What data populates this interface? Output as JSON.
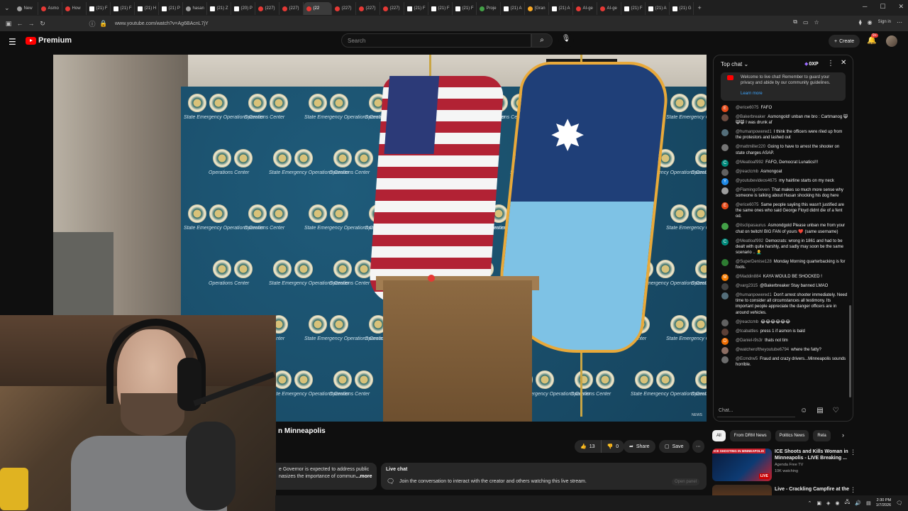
{
  "browser": {
    "tabs": [
      {
        "label": "New",
        "icon": "new-tab-icon"
      },
      {
        "label": "Asmo",
        "icon": "youtube-icon"
      },
      {
        "label": "How",
        "icon": "youtube-icon"
      },
      {
        "label": "(21) F",
        "icon": "x-icon"
      },
      {
        "label": "(21) F",
        "icon": "x-icon"
      },
      {
        "label": "(21) H",
        "icon": "x-icon"
      },
      {
        "label": "(21) P",
        "icon": "x-icon"
      },
      {
        "label": "hasan",
        "icon": "web-icon"
      },
      {
        "label": "(21) Z",
        "icon": "x-icon"
      },
      {
        "label": "(20) P",
        "icon": "x-icon"
      },
      {
        "label": "(227)",
        "icon": "youtube-icon"
      },
      {
        "label": "(227)",
        "icon": "youtube-icon"
      },
      {
        "label": "(22",
        "icon": "youtube-icon",
        "active": true
      },
      {
        "label": "(227)",
        "icon": "youtube-icon"
      },
      {
        "label": "(227)",
        "icon": "youtube-icon"
      },
      {
        "label": "(227)",
        "icon": "youtube-icon"
      },
      {
        "label": "(21) F",
        "icon": "x-icon"
      },
      {
        "label": "(21) F",
        "icon": "x-icon"
      },
      {
        "label": "(21) F",
        "icon": "x-icon"
      },
      {
        "label": "Proje",
        "icon": "project-icon"
      },
      {
        "label": "(21) A",
        "icon": "x-icon"
      },
      {
        "label": "[Gran",
        "icon": "gran-icon"
      },
      {
        "label": "(21) A",
        "icon": "x-icon"
      },
      {
        "label": "AI-ge",
        "icon": "youtube-icon"
      },
      {
        "label": "AI-ge",
        "icon": "youtube-icon"
      },
      {
        "label": "(21) F",
        "icon": "x-icon"
      },
      {
        "label": "(21) A",
        "icon": "x-icon"
      },
      {
        "label": "(21) G",
        "icon": "x-icon"
      }
    ],
    "url": "www.youtube.com/watch?v=Ag6BAcnL7jY",
    "sign_in": "Sign in"
  },
  "youtube": {
    "brand": "Premium",
    "search_placeholder": "Search",
    "create_label": "Create",
    "notif_count": "9+"
  },
  "video": {
    "clock_text": "59",
    "backdrop_caption": "State Emergency Operations Center",
    "backdrop_caption_short": "Operations Center",
    "news_bug": "NEWS"
  },
  "below": {
    "title": "n Minneapolis",
    "likes": "13",
    "dislikes": "0",
    "share": "Share",
    "save": "Save",
    "description_line1": "e Governor is expected to address public",
    "description_line2": "nasizes the importance of commun",
    "description_more": "...more",
    "live_chat_heading": "Live chat",
    "live_chat_text": "Join the conversation to interact with the creator and others watching this live stream.",
    "open_panel": "Open panel"
  },
  "chat": {
    "header": "Top chat",
    "xp": "0XP",
    "welcome": "Welcome to live chat! Remember to guard your privacy and abide by our community guidelines.",
    "learn_more": "Learn more",
    "input_placeholder": "Chat...",
    "messages": [
      {
        "user": "@erice6075",
        "text": "FAFO",
        "avatar": "E",
        "color": "#e64a19"
      },
      {
        "user": "@Bakerbreaker",
        "text": "Asmongold! unban me bro : Cartmanog 😸😸😸 I was drunk af",
        "avatar": "",
        "color": "#6d4c41"
      },
      {
        "user": "@humanpowered1",
        "text": "I think the officers were riled up from the protestors and lashed out",
        "avatar": "",
        "color": "#546e7a"
      },
      {
        "user": "@mattmiller220",
        "text": "Going to have to arrest the shooter on state charges ASAP.",
        "avatar": "",
        "color": "#757575"
      },
      {
        "user": "@Meatloaf992",
        "text": "FAFO, Democrat Lunatics!!!",
        "avatar": "C",
        "color": "#00897b"
      },
      {
        "user": "@jreactcmb",
        "text": "Asmongoat",
        "avatar": "",
        "color": "#616161"
      },
      {
        "user": "@youtubevideos4675",
        "text": "my hairline starts on my neck",
        "avatar": "Y",
        "color": "#1e88e5"
      },
      {
        "user": "@FlamingoSeven",
        "text": "That makes so much more sense why someone is talking about Hasan shocking his dog here",
        "avatar": "",
        "color": "#9e9e9e"
      },
      {
        "user": "@erice6075",
        "text": "Same people sayiing this wasn't justified are the same ones who said George Floyd didnt die of a fent od.",
        "avatar": "E",
        "color": "#e64a19"
      },
      {
        "user": "@itsclipasaurus",
        "text": "Asmondgold Please unban me from your chat on twitch! BIG FAN of yours ❤️ (same username)",
        "avatar": "",
        "color": "#43a047"
      },
      {
        "user": "@Meatloaf992",
        "text": "Democrats: wrong in 1861 and had to be dealt with quite harshly, and sadly may soon be the same scenario .. 👨‍🦲",
        "avatar": "C",
        "color": "#00897b"
      },
      {
        "user": "@SuperDenise128",
        "text": "Monday Morning quarterbacking is for fools.",
        "avatar": "",
        "color": "#2e7d32"
      },
      {
        "user": "@Maddin884",
        "text": "KAYA WOULD BE SHOCKED !",
        "avatar": "M",
        "color": "#f57c00"
      },
      {
        "user": "@varg2315",
        "text": "@Bakerbreaker Stay banned LMAO",
        "avatar": "",
        "color": "#424242"
      },
      {
        "user": "@humanpowered1",
        "text": "Don't arrest shooter immediately. Need time to consider all circumstances all testimony. Its important people appreciate the danger officers are in around vehicles.",
        "avatar": "",
        "color": "#546e7a"
      },
      {
        "user": "@jreactcmb",
        "text": "😂😂😂😂😂😂",
        "avatar": "",
        "color": "#616161"
      },
      {
        "user": "@tcabattles",
        "text": "press 1 if asmon is bald",
        "avatar": "",
        "color": "#5d4037"
      },
      {
        "user": "@Daniel-i9s3r",
        "text": "thats not tim",
        "avatar": "D",
        "color": "#ef6c00"
      },
      {
        "user": "@watcheroftheyoutube6794",
        "text": "where the fatty?",
        "avatar": "",
        "color": "#8d6e63"
      },
      {
        "user": "@Ecmdrw5",
        "text": "Fraud and crazy drivers...Minneapolis sounds horrible.",
        "avatar": "",
        "color": "#6d6d6d"
      }
    ]
  },
  "chips": [
    "All",
    "From DRM News",
    "Politics News",
    "Rela"
  ],
  "related": [
    {
      "title": "ICE Shoots and Kills Woman in Minneapolis - LIVE Breaking ...",
      "channel": "Agenda Free TV",
      "watching": "10K watching",
      "thumb_tag": "ICE SHOOTING IN MINNEAPOLIS",
      "live": "LIVE"
    },
    {
      "title": "Live - Crackling Campfire at the",
      "channel": "",
      "watching": "",
      "thumb_tag": "",
      "live": ""
    }
  ],
  "taskbar": {
    "time": "2:30 PM",
    "date": "1/7/2026"
  }
}
